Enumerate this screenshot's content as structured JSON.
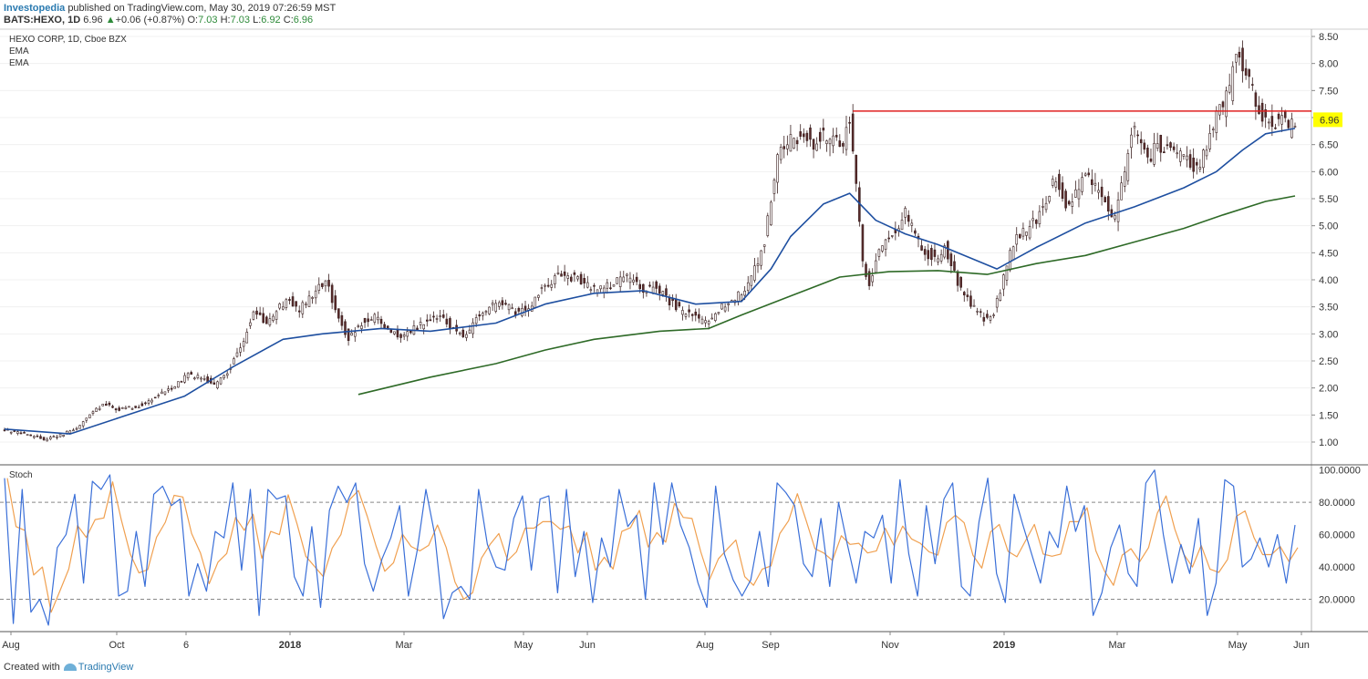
{
  "header": {
    "brand": "Investopedia",
    "published": "published on TradingView.com, May 30, 2019 07:26:59 MST",
    "symbol": "BATS:HEXO, 1D",
    "last": "6.96",
    "change_arrow": "▲",
    "change": "+0.06 (+0.87%)",
    "o_label": "O:",
    "o_value": "7.03",
    "h_label": "H:",
    "h_value": "7.03",
    "l_label": "L:",
    "l_value": "6.92",
    "c_label": "C:",
    "c_value": "6.96"
  },
  "legend": {
    "title": "HEXO CORP, 1D, Cboe BZX",
    "ema1": "EMA",
    "ema2": "EMA",
    "stoch": "Stoch"
  },
  "footer": {
    "created": "Created with",
    "brand": "TradingView"
  },
  "colors": {
    "up": "#ffffff",
    "down": "#5a2b2b",
    "wick": "#3a2020",
    "ema_fast": "#1e4fa0",
    "ema_slow": "#2e6a27",
    "resistance": "#e02020",
    "price_tag": "#ffff00",
    "stoch_k": "#3a6fd8",
    "stoch_d": "#f0a050"
  },
  "chart_data": {
    "type": "candlestick",
    "title": "HEXO CORP, 1D, Cboe BZX",
    "x_labels": [
      "Aug",
      "Oct",
      "6",
      "2018",
      "Mar",
      "May",
      "Jun",
      "Aug",
      "Sep",
      "Nov",
      "2019",
      "Mar",
      "May",
      "Jun"
    ],
    "y_ticks": [
      "8.50",
      "8.00",
      "7.50",
      "7.00",
      "6.50",
      "6.00",
      "5.50",
      "5.00",
      "4.50",
      "4.00",
      "3.50",
      "3.00",
      "2.50",
      "2.00",
      "1.50",
      "1.00"
    ],
    "ylim": [
      0.8,
      8.6
    ],
    "last_price": "6.96",
    "resistance_level": 7.12,
    "close_path": [
      [
        0,
        1.22
      ],
      [
        6,
        1.15
      ],
      [
        12,
        1.05
      ],
      [
        15,
        1.1
      ],
      [
        18,
        1.15
      ],
      [
        22,
        1.25
      ],
      [
        26,
        1.5
      ],
      [
        30,
        1.7
      ],
      [
        35,
        1.6
      ],
      [
        40,
        1.65
      ],
      [
        44,
        1.75
      ],
      [
        48,
        1.9
      ],
      [
        52,
        2.05
      ],
      [
        56,
        2.25
      ],
      [
        60,
        2.2
      ],
      [
        64,
        2.05
      ],
      [
        68,
        2.3
      ],
      [
        72,
        2.75
      ],
      [
        76,
        3.4
      ],
      [
        80,
        3.2
      ],
      [
        84,
        3.5
      ],
      [
        87,
        3.6
      ],
      [
        90,
        3.45
      ],
      [
        94,
        3.7
      ],
      [
        98,
        4.0
      ],
      [
        102,
        3.3
      ],
      [
        105,
        2.9
      ],
      [
        109,
        3.2
      ],
      [
        113,
        3.3
      ],
      [
        117,
        3.1
      ],
      [
        121,
        2.9
      ],
      [
        125,
        3.1
      ],
      [
        129,
        3.25
      ],
      [
        133,
        3.3
      ],
      [
        137,
        3.1
      ],
      [
        141,
        2.95
      ],
      [
        144,
        3.3
      ],
      [
        148,
        3.5
      ],
      [
        152,
        3.55
      ],
      [
        156,
        3.4
      ],
      [
        160,
        3.5
      ],
      [
        165,
        3.9
      ],
      [
        170,
        4.1
      ],
      [
        175,
        4.0
      ],
      [
        180,
        3.85
      ],
      [
        185,
        3.9
      ],
      [
        190,
        4.05
      ],
      [
        195,
        3.8
      ],
      [
        199,
        3.9
      ],
      [
        203,
        3.6
      ],
      [
        207,
        3.4
      ],
      [
        211,
        3.3
      ],
      [
        214,
        3.2
      ],
      [
        217,
        3.4
      ],
      [
        221,
        3.6
      ],
      [
        225,
        3.75
      ],
      [
        229,
        4.2
      ],
      [
        232,
        4.7
      ],
      [
        234,
        5.5
      ],
      [
        236,
        6.2
      ],
      [
        238,
        6.5
      ],
      [
        241,
        6.6
      ],
      [
        244,
        6.7
      ],
      [
        247,
        6.5
      ],
      [
        250,
        6.7
      ],
      [
        253,
        6.6
      ],
      [
        256,
        6.55
      ],
      [
        258,
        6.9
      ],
      [
        260,
        5.8
      ],
      [
        262,
        4.3
      ],
      [
        264,
        3.9
      ],
      [
        266,
        4.4
      ],
      [
        269,
        4.7
      ],
      [
        272,
        4.9
      ],
      [
        275,
        5.3
      ],
      [
        278,
        4.8
      ],
      [
        281,
        4.5
      ],
      [
        284,
        4.4
      ],
      [
        287,
        4.6
      ],
      [
        290,
        4.1
      ],
      [
        293,
        3.7
      ],
      [
        296,
        3.5
      ],
      [
        299,
        3.3
      ],
      [
        302,
        3.4
      ],
      [
        304,
        3.8
      ],
      [
        306,
        4.3
      ],
      [
        309,
        4.8
      ],
      [
        312,
        4.9
      ],
      [
        315,
        5.1
      ],
      [
        318,
        5.5
      ],
      [
        321,
        5.9
      ],
      [
        324,
        5.4
      ],
      [
        327,
        5.6
      ],
      [
        330,
        6.0
      ],
      [
        333,
        5.7
      ],
      [
        336,
        5.4
      ],
      [
        339,
        5.2
      ],
      [
        342,
        6.0
      ],
      [
        344,
        6.8
      ],
      [
        346,
        6.7
      ],
      [
        349,
        6.2
      ],
      [
        352,
        6.5
      ],
      [
        355,
        6.4
      ],
      [
        358,
        6.3
      ],
      [
        361,
        6.2
      ],
      [
        364,
        6.0
      ],
      [
        367,
        6.5
      ],
      [
        370,
        7.0
      ],
      [
        372,
        7.2
      ],
      [
        374,
        7.5
      ],
      [
        376,
        8.3
      ],
      [
        378,
        7.9
      ],
      [
        380,
        7.7
      ],
      [
        382,
        7.3
      ],
      [
        384,
        7.0
      ],
      [
        386,
        6.9
      ],
      [
        388,
        6.9
      ],
      [
        390,
        7.0
      ],
      [
        392,
        6.8
      ],
      [
        394,
        6.96
      ]
    ],
    "ema_fast": [
      [
        0,
        1.24
      ],
      [
        20,
        1.15
      ],
      [
        35,
        1.45
      ],
      [
        55,
        1.85
      ],
      [
        70,
        2.4
      ],
      [
        85,
        2.9
      ],
      [
        97,
        3.0
      ],
      [
        115,
        3.1
      ],
      [
        130,
        3.05
      ],
      [
        150,
        3.2
      ],
      [
        165,
        3.55
      ],
      [
        180,
        3.75
      ],
      [
        195,
        3.8
      ],
      [
        211,
        3.55
      ],
      [
        225,
        3.6
      ],
      [
        234,
        4.2
      ],
      [
        240,
        4.8
      ],
      [
        250,
        5.4
      ],
      [
        258,
        5.6
      ],
      [
        266,
        5.1
      ],
      [
        275,
        4.85
      ],
      [
        285,
        4.65
      ],
      [
        295,
        4.4
      ],
      [
        303,
        4.2
      ],
      [
        315,
        4.6
      ],
      [
        330,
        5.05
      ],
      [
        345,
        5.35
      ],
      [
        360,
        5.7
      ],
      [
        370,
        6.0
      ],
      [
        378,
        6.4
      ],
      [
        385,
        6.7
      ],
      [
        394,
        6.8
      ]
    ],
    "ema_slow": [
      [
        108,
        1.88
      ],
      [
        130,
        2.2
      ],
      [
        150,
        2.45
      ],
      [
        165,
        2.7
      ],
      [
        180,
        2.9
      ],
      [
        200,
        3.05
      ],
      [
        215,
        3.1
      ],
      [
        225,
        3.35
      ],
      [
        240,
        3.7
      ],
      [
        255,
        4.05
      ],
      [
        270,
        4.15
      ],
      [
        285,
        4.17
      ],
      [
        300,
        4.1
      ],
      [
        315,
        4.3
      ],
      [
        330,
        4.45
      ],
      [
        345,
        4.7
      ],
      [
        360,
        4.95
      ],
      [
        372,
        5.2
      ],
      [
        385,
        5.45
      ],
      [
        394,
        5.55
      ]
    ],
    "stochastic": {
      "ylim": [
        0,
        100
      ],
      "y_ticks": [
        "100.0000",
        "80.0000",
        "60.0000",
        "40.0000",
        "20.0000"
      ],
      "bands": [
        80,
        20
      ],
      "k": [
        95,
        5,
        88,
        12,
        20,
        4,
        52,
        60,
        85,
        30,
        93,
        88,
        97,
        22,
        25,
        62,
        28,
        85,
        90,
        78,
        82,
        22,
        42,
        25,
        62,
        58,
        92,
        38,
        88,
        10,
        88,
        82,
        84,
        34,
        22,
        65,
        15,
        75,
        90,
        80,
        92,
        42,
        25,
        45,
        58,
        78,
        22,
        50,
        88,
        60,
        8,
        24,
        28,
        20,
        88,
        54,
        40,
        38,
        70,
        84,
        38,
        82,
        84,
        24,
        88,
        34,
        62,
        18,
        58,
        40,
        88,
        65,
        72,
        20,
        92,
        54,
        92,
        66,
        52,
        30,
        15,
        90,
        48,
        32,
        22,
        32,
        62,
        28,
        92,
        86,
        78,
        42,
        34,
        70,
        28,
        80,
        54,
        30,
        62,
        58,
        72,
        30,
        94,
        48,
        22,
        78,
        42,
        82,
        92,
        28,
        22,
        68,
        95,
        36,
        18,
        85,
        66,
        48,
        30,
        62,
        52,
        90,
        62,
        78,
        10,
        24,
        52,
        66,
        36,
        28,
        92,
        100,
        60,
        30,
        54,
        36,
        70,
        10,
        30,
        94,
        90,
        40,
        45,
        58,
        40,
        60,
        30,
        66
      ],
      "d_lag": 1
    }
  }
}
